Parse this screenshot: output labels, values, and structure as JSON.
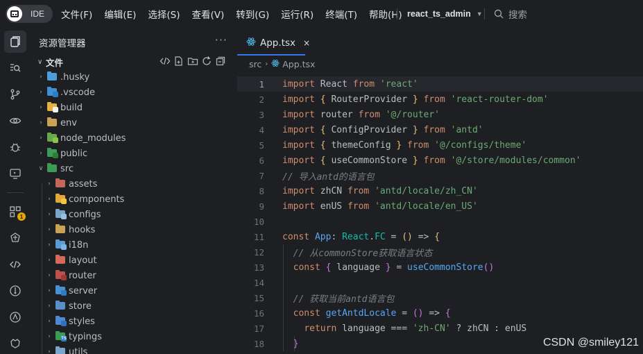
{
  "titlebar": {
    "logo_text": "IDE",
    "menu": [
      "文件(F)",
      "编辑(E)",
      "选择(S)",
      "查看(V)",
      "转到(G)",
      "运行(R)",
      "终端(T)",
      "帮助(H)"
    ],
    "project": "react_ts_admin",
    "search_label": "搜索"
  },
  "activity": {
    "icons": [
      "explorer-icon",
      "search-icon",
      "source-control-icon",
      "watch-icon",
      "debug-icon",
      "remote-icon",
      "extensions-icon",
      "plugin-icon",
      "code-icon",
      "git-icon",
      "ai-icon",
      "settings-icon"
    ],
    "extensions_badge": "1"
  },
  "explorer": {
    "title": "资源管理器",
    "more": "···",
    "section_label": "文件",
    "items": [
      {
        "name": ".husky",
        "color": "#4d9ed8",
        "mark": "",
        "mark_color": ""
      },
      {
        "name": ".vscode",
        "color": "#3f8fd4",
        "mark": "",
        "mark_color": "#2f7cc6"
      },
      {
        "name": "build",
        "color": "#e3b341",
        "mark": "",
        "mark_color": "#f2f2f2"
      },
      {
        "name": "env",
        "color": "#c9a255",
        "mark": "",
        "mark_color": ""
      },
      {
        "name": "node_modules",
        "color": "#6aa84f",
        "mark": "",
        "mark_color": "#8bc34a"
      },
      {
        "name": "public",
        "color": "#3c9b57",
        "mark": "",
        "mark_color": "#2e7d32"
      },
      {
        "name": "src",
        "color": "#3c9b57",
        "mark": "",
        "mark_color": ""
      },
      {
        "name": "assets",
        "color": "#c2685a",
        "mark": "",
        "mark_color": ""
      },
      {
        "name": "components",
        "color": "#e0a93a",
        "mark": "",
        "mark_color": "#f5c542"
      },
      {
        "name": "configs",
        "color": "#7aa7c9",
        "mark": "",
        "mark_color": "#9bc1de"
      },
      {
        "name": "hooks",
        "color": "#c9a255",
        "mark": "",
        "mark_color": ""
      },
      {
        "name": "i18n",
        "color": "#5b9bd5",
        "mark": "",
        "mark_color": "#7fb3e6"
      },
      {
        "name": "layout",
        "color": "#d66a5a",
        "mark": "",
        "mark_color": ""
      },
      {
        "name": "router",
        "color": "#c0504d",
        "mark": "",
        "mark_color": "#9c3c3a"
      },
      {
        "name": "server",
        "color": "#4a8fcf",
        "mark": "",
        "mark_color": "#2f7cc6"
      },
      {
        "name": "store",
        "color": "#5a8fc9",
        "mark": "",
        "mark_color": ""
      },
      {
        "name": "styles",
        "color": "#4f8ad1",
        "mark": "",
        "mark_color": "#2f6fbf"
      },
      {
        "name": "typings",
        "color": "#3c9b57",
        "mark": "TS",
        "mark_color": "#2f7cc6"
      },
      {
        "name": "utils",
        "color": "#7aa7c9",
        "mark": "",
        "mark_color": ""
      }
    ]
  },
  "editor": {
    "tab_label": "App.tsx",
    "tab_close": "×",
    "breadcrumb_folder": "src",
    "breadcrumb_file": "App.tsx",
    "line_numbers": [
      "1",
      "2",
      "3",
      "4",
      "5",
      "6",
      "7",
      "8",
      "9",
      "10",
      "11",
      "12",
      "13",
      "14",
      "15",
      "16",
      "17",
      "18"
    ]
  },
  "watermark": "CSDN @smiley121",
  "colors": {
    "accent": "#3574f0",
    "background": "#1e1f22",
    "keyword": "#cf8e6d",
    "string": "#6aab73",
    "comment": "#7a7e85",
    "function": "#56a8f5",
    "type": "#16baac"
  }
}
